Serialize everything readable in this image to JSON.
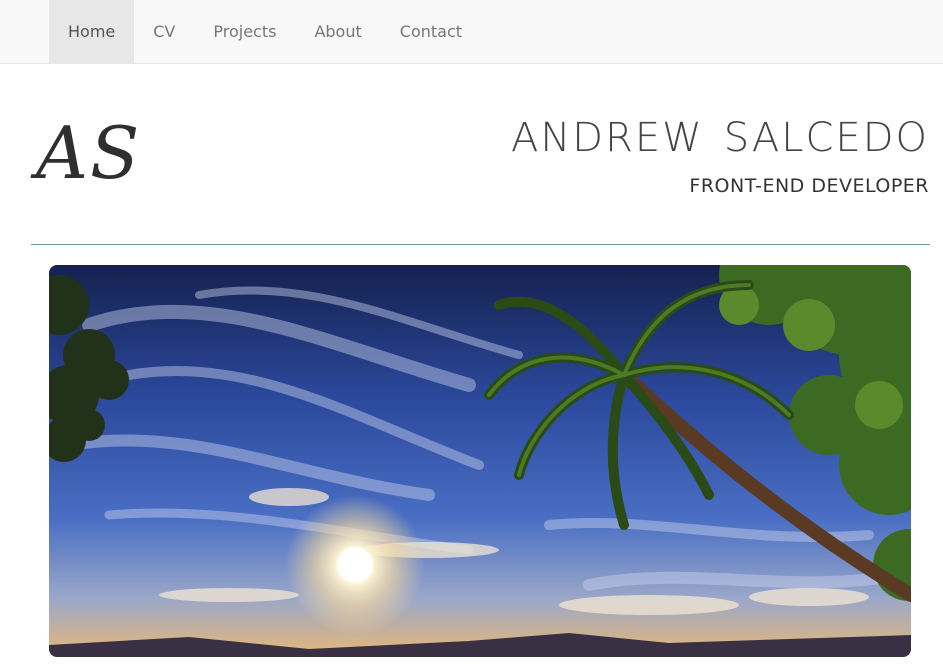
{
  "nav": {
    "items": [
      {
        "label": "Home",
        "active": true
      },
      {
        "label": "CV",
        "active": false
      },
      {
        "label": "Projects",
        "active": false
      },
      {
        "label": "About",
        "active": false
      },
      {
        "label": "Contact",
        "active": false
      }
    ]
  },
  "header": {
    "logo_text": "AS",
    "name_first": "ANDREW",
    "name_last": "SALCEDO",
    "title": "FRONT-END DEVELOPER"
  },
  "hero": {
    "image_subject": "tropical-sunset-palm-trees",
    "colors": {
      "sky_top": "#1a2a6c",
      "sky_mid": "#3b5fc0",
      "horizon": "#f2c27a",
      "palm": "#2e4a1a",
      "foliage": "#3f6b22"
    }
  }
}
